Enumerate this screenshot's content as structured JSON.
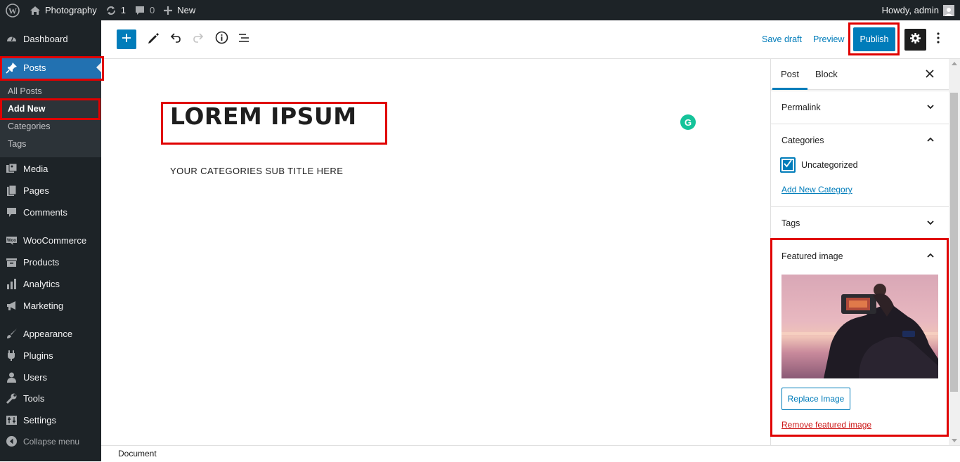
{
  "admin_bar": {
    "site_name": "Photography",
    "updates_count": "1",
    "comments_count": "0",
    "new_label": "New",
    "greeting": "Howdy, admin"
  },
  "sidebar": {
    "items": [
      {
        "label": "Dashboard",
        "icon": "dashboard-icon"
      },
      {
        "label": "Posts",
        "icon": "pin-icon"
      },
      {
        "label": "Media",
        "icon": "media-icon"
      },
      {
        "label": "Pages",
        "icon": "pages-icon"
      },
      {
        "label": "Comments",
        "icon": "comment-icon"
      },
      {
        "label": "WooCommerce",
        "icon": "woocommerce-icon"
      },
      {
        "label": "Products",
        "icon": "archive-icon"
      },
      {
        "label": "Analytics",
        "icon": "bar-chart-icon"
      },
      {
        "label": "Marketing",
        "icon": "megaphone-icon"
      },
      {
        "label": "Appearance",
        "icon": "brush-icon"
      },
      {
        "label": "Plugins",
        "icon": "plugin-icon"
      },
      {
        "label": "Users",
        "icon": "user-icon"
      },
      {
        "label": "Tools",
        "icon": "wrench-icon"
      },
      {
        "label": "Settings",
        "icon": "settings-icon"
      },
      {
        "label": "Collapse menu",
        "icon": "collapse-icon"
      }
    ],
    "submenu": [
      "All Posts",
      "Add New",
      "Categories",
      "Tags"
    ],
    "accent_color": "#2271b1"
  },
  "toolbar": {
    "save_draft": "Save draft",
    "preview": "Preview",
    "publish": "Publish"
  },
  "editor": {
    "title": "LOREM IPSUM",
    "subtitle": "YOUR CATEGORIES SUB TITLE HERE",
    "grammarly": "G"
  },
  "panel": {
    "tab_post": "Post",
    "tab_block": "Block",
    "permalink": "Permalink",
    "categories": "Categories",
    "category_item": "Uncategorized",
    "add_new_category": "Add New Category",
    "tags": "Tags",
    "featured_image": "Featured image",
    "replace_image": "Replace Image",
    "remove_featured_image": "Remove featured image"
  },
  "status_bar": {
    "breadcrumb": "Document"
  },
  "colors": {
    "primary": "#007cba",
    "highlight": "#e00000",
    "admin_dark": "#1d2327",
    "danger": "#cc1818"
  }
}
